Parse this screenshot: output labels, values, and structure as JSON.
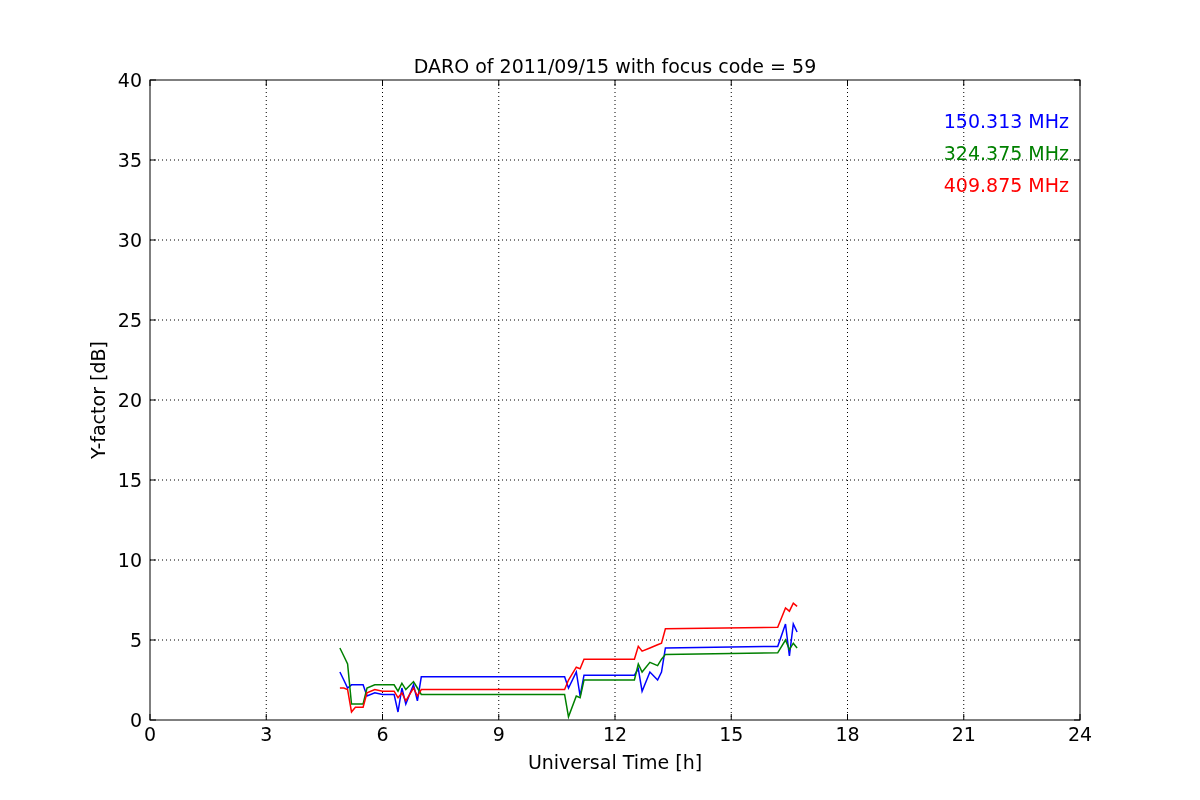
{
  "chart_data": {
    "type": "line",
    "title": "DARO of 2011/09/15 with focus code = 59",
    "xlabel": "Universal Time [h]",
    "ylabel": "Y-factor [dB]",
    "xlim": [
      0,
      24
    ],
    "ylim": [
      0,
      40
    ],
    "grid": true,
    "xticks": [
      0,
      3,
      6,
      9,
      12,
      15,
      18,
      21,
      24
    ],
    "yticks": [
      0,
      5,
      10,
      15,
      20,
      25,
      30,
      35,
      40
    ],
    "x": [
      4.9,
      5.0,
      5.1,
      5.2,
      5.3,
      5.5,
      5.6,
      5.8,
      6.0,
      6.3,
      6.4,
      6.5,
      6.6,
      6.8,
      6.9,
      7.0,
      10.7,
      10.8,
      11.0,
      11.1,
      11.2,
      12.5,
      12.6,
      12.7,
      12.9,
      13.1,
      13.2,
      13.3,
      16.2,
      16.4,
      16.5,
      16.6,
      16.7
    ],
    "series": [
      {
        "name": "150.313 MHz",
        "color": "#0000ff",
        "values": [
          3.0,
          2.5,
          2.0,
          2.2,
          2.2,
          2.2,
          1.5,
          1.7,
          1.6,
          1.6,
          0.5,
          2.0,
          1.0,
          2.2,
          1.2,
          2.7,
          2.7,
          2.0,
          3.0,
          1.5,
          2.8,
          2.8,
          3.2,
          1.8,
          3.0,
          2.5,
          3.0,
          4.5,
          4.6,
          6.0,
          4.0,
          6.0,
          5.5
        ]
      },
      {
        "name": "324.375 MHz",
        "color": "#008000",
        "values": [
          4.5,
          4.0,
          3.5,
          1.0,
          1.0,
          1.0,
          2.0,
          2.2,
          2.2,
          2.2,
          1.8,
          2.3,
          1.9,
          2.4,
          2.0,
          1.6,
          1.6,
          0.2,
          1.5,
          1.4,
          2.5,
          2.5,
          3.5,
          3.0,
          3.6,
          3.4,
          3.8,
          4.1,
          4.2,
          5.0,
          4.4,
          4.8,
          4.5
        ]
      },
      {
        "name": "409.875 MHz",
        "color": "#ff0000",
        "values": [
          2.0,
          2.0,
          1.9,
          0.5,
          0.8,
          0.8,
          1.7,
          1.9,
          1.8,
          1.8,
          1.4,
          1.7,
          1.2,
          2.0,
          1.5,
          1.9,
          1.9,
          2.5,
          3.3,
          3.2,
          3.8,
          3.8,
          4.6,
          4.3,
          4.5,
          4.7,
          4.8,
          5.7,
          5.8,
          7.0,
          6.8,
          7.3,
          7.1
        ]
      }
    ]
  }
}
